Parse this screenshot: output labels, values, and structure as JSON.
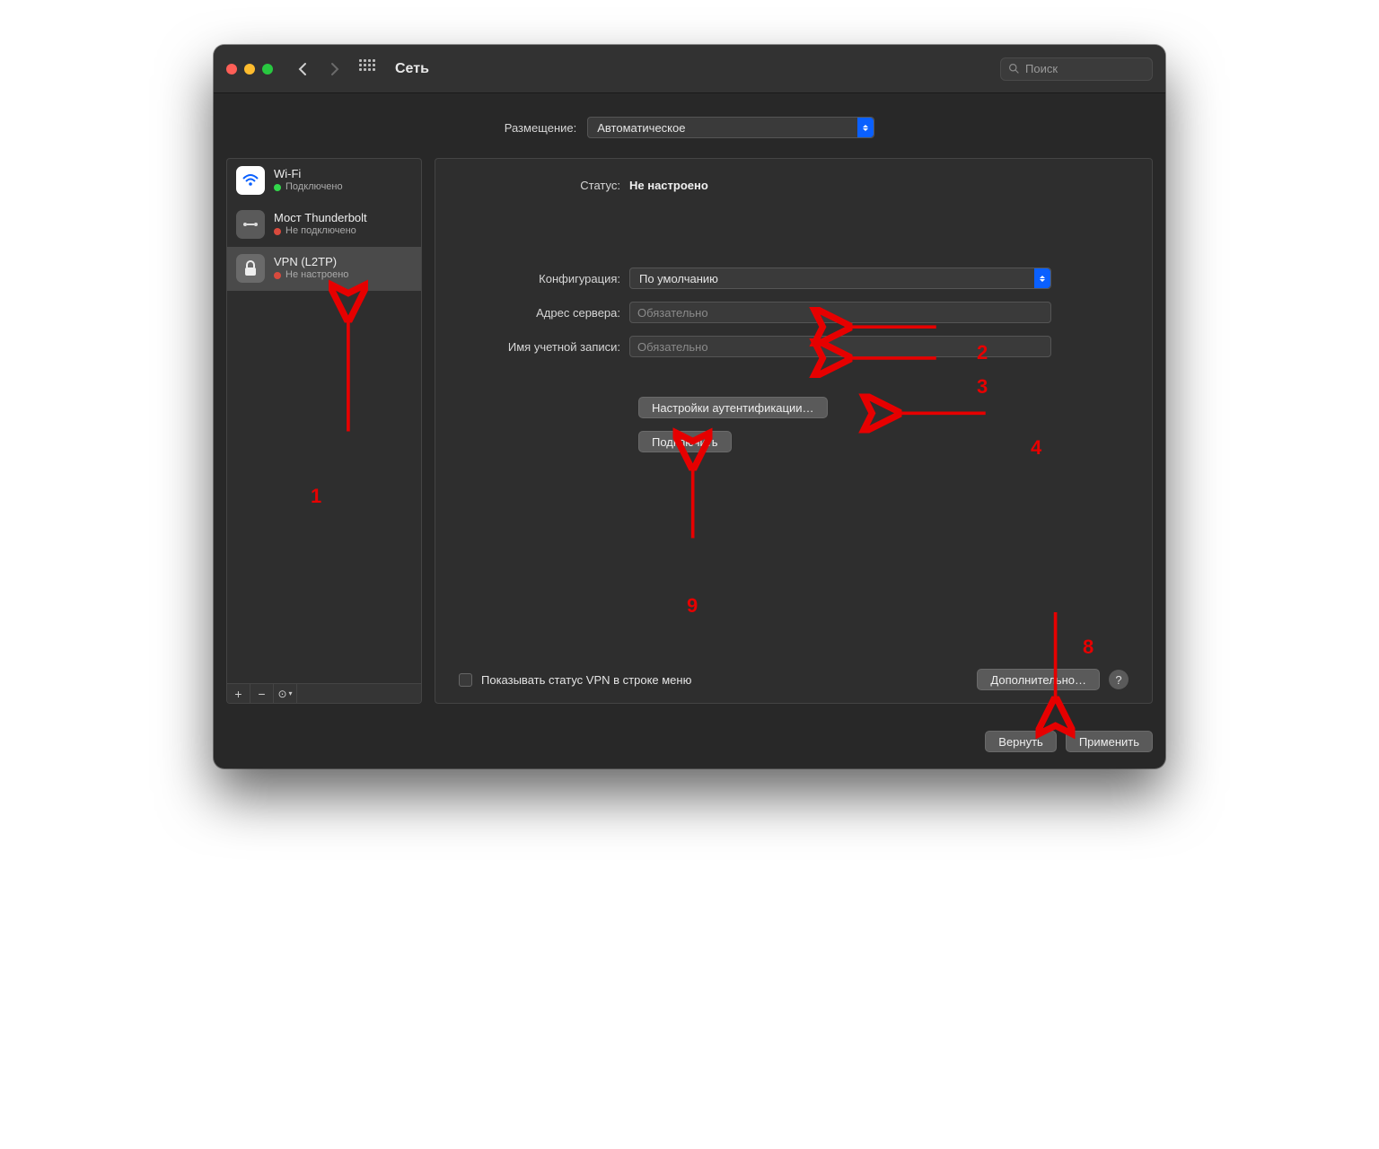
{
  "titlebar": {
    "title": "Сеть",
    "search_placeholder": "Поиск"
  },
  "location": {
    "label": "Размещение:",
    "value": "Автоматическое"
  },
  "sidebar": {
    "items": [
      {
        "title": "Wi-Fi",
        "subtitle": "Подключено",
        "status": "green",
        "icon": "wifi"
      },
      {
        "title": "Мост Thunderbolt",
        "subtitle": "Не подключено",
        "status": "red",
        "icon": "thunderbolt"
      },
      {
        "title": "VPN (L2TP)",
        "subtitle": "Не настроено",
        "status": "red",
        "icon": "lock"
      }
    ]
  },
  "main": {
    "status_label": "Статус:",
    "status_value": "Не настроено",
    "config_label": "Конфигурация:",
    "config_value": "По умолчанию",
    "server_label": "Адрес сервера:",
    "server_placeholder": "Обязательно",
    "account_label": "Имя учетной записи:",
    "account_placeholder": "Обязательно",
    "auth_button": "Настройки аутентификации…",
    "connect_button": "Подключить",
    "show_status_label": "Показывать статус VPN в строке меню",
    "advanced_button": "Дополнительно…",
    "help": "?"
  },
  "bottom": {
    "revert": "Вернуть",
    "apply": "Применить"
  },
  "annotations": {
    "a1": "1",
    "a2": "2",
    "a3": "3",
    "a4": "4",
    "a8": "8",
    "a9": "9"
  }
}
